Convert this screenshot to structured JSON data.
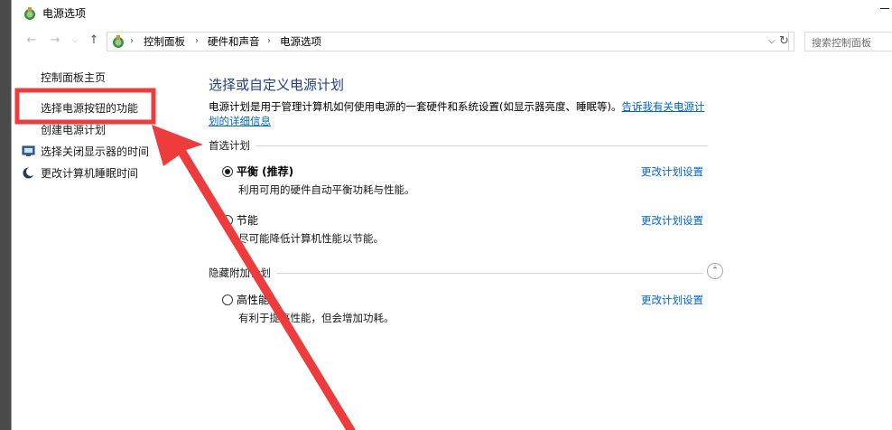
{
  "window": {
    "title": "电源选项",
    "title_icon": "power-options-icon"
  },
  "addressbar": {
    "crumbs": [
      "控制面板",
      "硬件和声音",
      "电源选项"
    ],
    "search_placeholder": "搜索控制面板"
  },
  "sidebar": {
    "items": [
      {
        "label": "控制面板主页",
        "icon": null
      },
      {
        "label": "选择电源按钮的功能",
        "icon": null
      },
      {
        "label": "创建电源计划",
        "icon": null
      },
      {
        "label": "选择关闭显示器的时间",
        "icon": "monitor-icon"
      },
      {
        "label": "更改计算机睡眠时间",
        "icon": "moon-icon"
      }
    ]
  },
  "main": {
    "heading": "选择或自定义电源计划",
    "description": "电源计划是用于管理计算机如何使用电源的一套硬件和系统设置(如显示器亮度、睡眠等)。",
    "description_link": "告诉我有关电源计划的详细信息",
    "preferred_section": "首选计划",
    "hidden_section": "隐藏附加计划",
    "plans": [
      {
        "name": "平衡 (推荐)",
        "description": "利用可用的硬件自动平衡功耗与性能。",
        "selected": true,
        "link": "更改计划设置"
      },
      {
        "name": "节能",
        "description": "尽可能降低计算机性能以节能。",
        "selected": false,
        "link": "更改计划设置"
      },
      {
        "name": "高性能",
        "description": "有利于提高性能，但会增加功耗。",
        "selected": false,
        "link": "更改计划设置"
      }
    ]
  },
  "colors": {
    "heading": "#1e3e8f",
    "link": "#0066cc",
    "annotation": "#ee3b3b"
  }
}
